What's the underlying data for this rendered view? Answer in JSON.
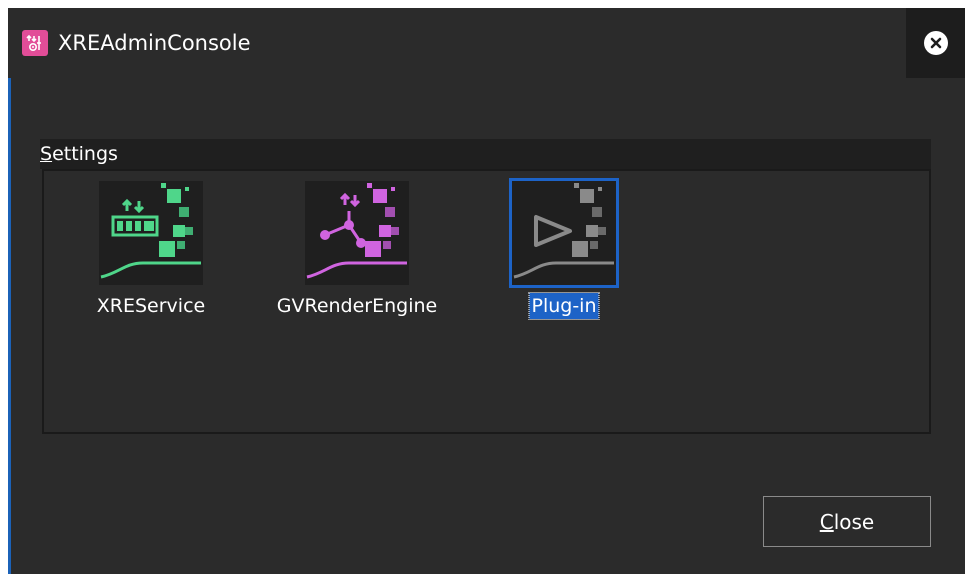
{
  "window": {
    "title": "XREAdminConsole",
    "app_icon": "gear-tool-icon",
    "close_icon": "close-circle-icon"
  },
  "settings": {
    "label_first": "S",
    "label_rest": "ettings",
    "items": [
      {
        "label": "XREService",
        "icon": "xre-service-icon",
        "color": "#4fd68a",
        "selected": false
      },
      {
        "label": "GVRenderEngine",
        "icon": "render-engine-icon",
        "color": "#d064e0",
        "selected": false
      },
      {
        "label": "Plug-in",
        "icon": "plugin-play-icon",
        "color": "#8a8a8a",
        "selected": true
      }
    ]
  },
  "footer": {
    "close_first": "C",
    "close_rest": "lose"
  },
  "colors": {
    "background": "#2b2b2b",
    "accent": "#1d63c7",
    "green": "#4fd68a",
    "magenta": "#d064e0"
  }
}
